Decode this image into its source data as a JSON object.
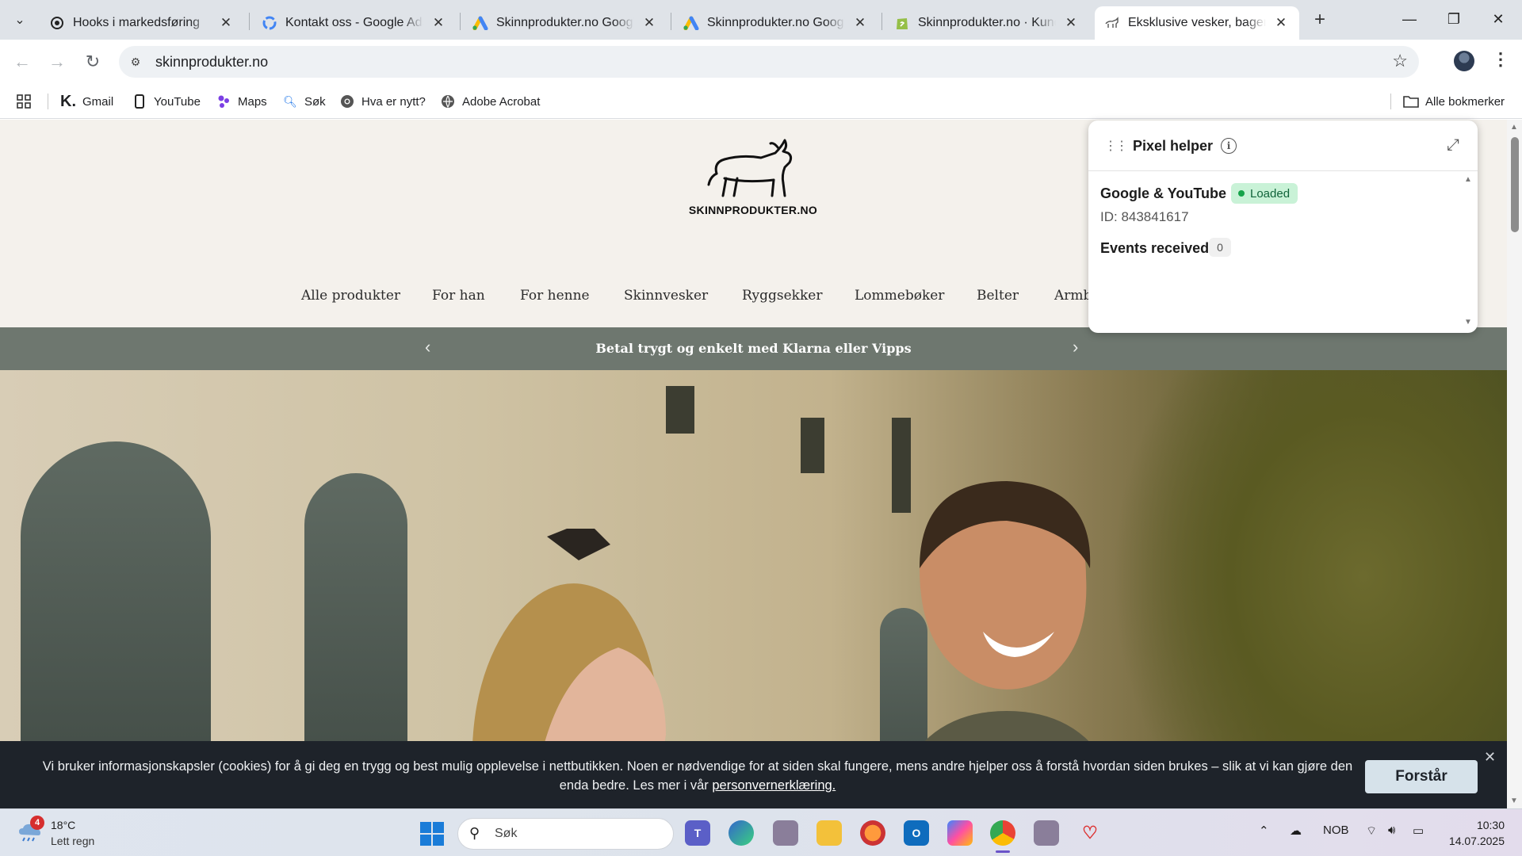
{
  "browser": {
    "tabs": [
      {
        "title": "Hooks i markedsføring",
        "icon": "openai-icon"
      },
      {
        "title": "Kontakt oss - Google Ads",
        "icon": "google-icon"
      },
      {
        "title": "Skinnprodukter.no Google",
        "icon": "google-ads-icon"
      },
      {
        "title": "Skinnprodukter.no Google",
        "icon": "google-ads-icon"
      },
      {
        "title": "Skinnprodukter.no · Kunde",
        "icon": "shopify-icon"
      },
      {
        "title": "Eksklusive vesker, bager og",
        "icon": "bull-favicon",
        "active": true
      }
    ],
    "url": "skinnprodukter.no",
    "bookmarks": [
      {
        "label": "Gmail",
        "icon": "klarna-k-icon"
      },
      {
        "label": "YouTube",
        "icon": "phone-icon"
      },
      {
        "label": "Maps",
        "icon": "maps-icon"
      },
      {
        "label": "Søk",
        "icon": "search-icon"
      },
      {
        "label": "Hva er nytt?",
        "icon": "chrome-icon"
      },
      {
        "label": "Adobe Acrobat",
        "icon": "globe-icon"
      }
    ],
    "all_bookmarks": "Alle bokmerker"
  },
  "site": {
    "logo_text": "SKINNPRODUKTER.NO",
    "nav": [
      "Alle produkter",
      "For han",
      "For henne",
      "Skinnvesker",
      "Ryggsekker",
      "Lommebøker",
      "Belter",
      "Armb"
    ],
    "announcement": "Betal trygt og enkelt med Klarna eller Vipps"
  },
  "cookie": {
    "text": "Vi bruker informasjonskapsler (cookies) for å gi deg en trygg og best mulig opplevelse i nettbutikken. Noen er nødvendige for at siden skal fungere, mens andre hjelper oss å forstå hvordan siden brukes – slik at vi kan gjøre den enda bedre. Les mer i vår",
    "link": "personvernerklæring.",
    "button": "Forstår"
  },
  "pixel_helper": {
    "title": "Pixel helper",
    "tag_name": "Google & YouTube",
    "status": "Loaded",
    "status_color": "#16a34a",
    "id_line": "ID: 843841617",
    "events_label": "Events received",
    "events_count": "0"
  },
  "taskbar": {
    "weather_badge": "4",
    "temperature": "18°C",
    "condition": "Lett regn",
    "search_label": "Søk",
    "language": "NOB",
    "time": "10:30",
    "date": "14.07.2025"
  },
  "colors": {
    "announcement_bg": "#6e776f",
    "header_bg": "#f4f1ec",
    "cookie_bg": "#1e232a"
  }
}
